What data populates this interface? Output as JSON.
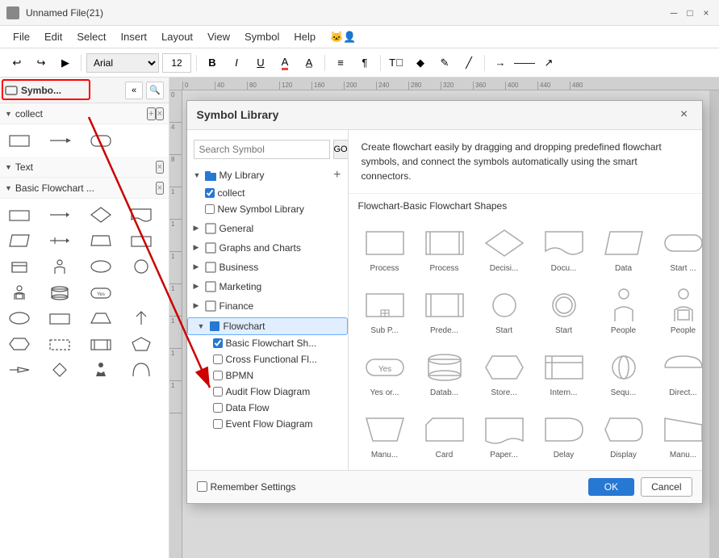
{
  "titlebar": {
    "title": "Unnamed File(21)",
    "buttons": [
      "minimize",
      "restore",
      "close"
    ]
  },
  "menubar": {
    "items": [
      "File",
      "Edit",
      "Select",
      "Insert",
      "Layout",
      "View",
      "Symbol",
      "Help",
      "🐱‍👤"
    ]
  },
  "toolbar": {
    "undo": "↩",
    "redo": "↪",
    "font_name": "Arial",
    "font_size": "12",
    "bold": "B",
    "italic": "I",
    "underline": "U"
  },
  "left_panel": {
    "title": "Symbo...",
    "search_icon": "🔍",
    "collapse_icon": "«",
    "section_collect": "collect",
    "section_text": "Text",
    "section_flowchart": "Basic Flowchart ..."
  },
  "modal": {
    "title": "Symbol Library",
    "close_icon": "×",
    "search_placeholder": "Search Symbol",
    "search_btn": "GO",
    "description": "Create flowchart easily by dragging and dropping predefined flowchart symbols, and connect the symbols automatically using the smart connectors.",
    "shapes_section_title": "Flowchart-Basic Flowchart Shapes",
    "remember_label": "Remember Settings",
    "ok_btn": "OK",
    "cancel_btn": "Cancel",
    "tree": {
      "my_library": {
        "label": "My Library",
        "add_icon": "+",
        "items": [
          {
            "id": "collect",
            "label": "collect",
            "checked": true
          },
          {
            "id": "new_symbol_library",
            "label": "New Symbol Library",
            "checked": false
          }
        ]
      },
      "categories": [
        {
          "id": "general",
          "label": "General",
          "expanded": false
        },
        {
          "id": "graphs_charts",
          "label": "Graphs and Charts",
          "expanded": false
        },
        {
          "id": "business",
          "label": "Business",
          "expanded": false
        },
        {
          "id": "marketing",
          "label": "Marketing",
          "expanded": false
        },
        {
          "id": "finance",
          "label": "Finance",
          "expanded": false
        },
        {
          "id": "flowchart",
          "label": "Flowchart",
          "expanded": true,
          "items": [
            {
              "id": "basic_flowchart",
              "label": "Basic Flowchart Sh...",
              "checked": true,
              "selected": false
            },
            {
              "id": "cross_functional",
              "label": "Cross Functional Fl...",
              "checked": false
            },
            {
              "id": "bpmn",
              "label": "BPMN",
              "checked": false
            },
            {
              "id": "audit_flow",
              "label": "Audit Flow Diagram",
              "checked": false
            },
            {
              "id": "data_flow",
              "label": "Data Flow",
              "checked": false
            },
            {
              "id": "event_flow",
              "label": "Event Flow Diagram",
              "checked": false
            }
          ]
        }
      ]
    },
    "shapes": [
      {
        "id": "process1",
        "label": "Process"
      },
      {
        "id": "process2",
        "label": "Process"
      },
      {
        "id": "decision",
        "label": "Decisi..."
      },
      {
        "id": "document",
        "label": "Docu..."
      },
      {
        "id": "data",
        "label": "Data"
      },
      {
        "id": "start_end",
        "label": "Start ..."
      },
      {
        "id": "sub_process",
        "label": "Sub P..."
      },
      {
        "id": "predefined",
        "label": "Prede..."
      },
      {
        "id": "start",
        "label": "Start"
      },
      {
        "id": "start2",
        "label": "Start"
      },
      {
        "id": "people1",
        "label": "People"
      },
      {
        "id": "people2",
        "label": "People"
      },
      {
        "id": "yes_no",
        "label": "Yes or..."
      },
      {
        "id": "database",
        "label": "Datab..."
      },
      {
        "id": "stored_data",
        "label": "Store..."
      },
      {
        "id": "internal",
        "label": "Intern..."
      },
      {
        "id": "sequential",
        "label": "Sequ..."
      },
      {
        "id": "direct",
        "label": "Direct..."
      },
      {
        "id": "manual",
        "label": "Manu..."
      },
      {
        "id": "card",
        "label": "Card"
      },
      {
        "id": "paper",
        "label": "Paper..."
      },
      {
        "id": "delay",
        "label": "Delay"
      },
      {
        "id": "display",
        "label": "Display"
      },
      {
        "id": "manual2",
        "label": "Manu..."
      }
    ]
  },
  "ruler": {
    "marks": [
      "0",
      "40",
      "80",
      "120",
      "160",
      "200",
      "240",
      "280",
      "320",
      "360",
      "400",
      "440",
      "480"
    ]
  },
  "colors": {
    "accent_blue": "#2678d2",
    "red_highlight": "#cc0000",
    "tree_icon_blue": "#2678d2"
  }
}
